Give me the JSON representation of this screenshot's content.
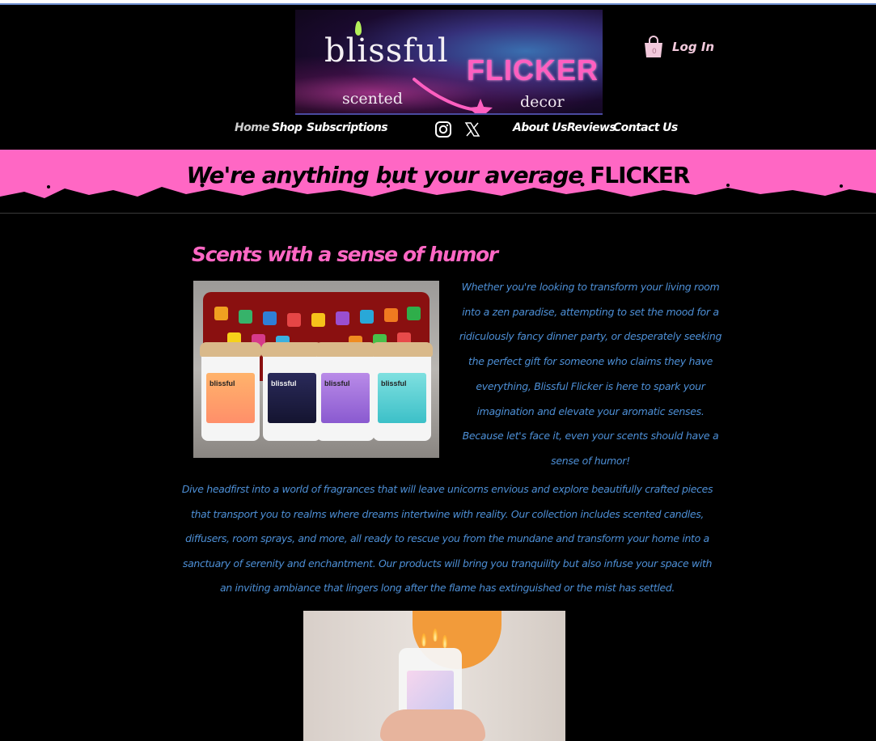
{
  "header": {
    "logo": {
      "brand_line1": "blissful",
      "brand_line2": "FLICKER",
      "tagline_left": "scented",
      "tagline_right": "decor"
    },
    "login_label": "Log In"
  },
  "nav": {
    "left": [
      "Home",
      "Shop",
      "Subscriptions"
    ],
    "right": [
      "About Us",
      "Reviews",
      "Contact Us"
    ],
    "active": "Home"
  },
  "social": [
    "instagram-icon",
    "x-icon"
  ],
  "banner": {
    "text_italic": "We're anything but your average",
    "text_bold": "FLICKER"
  },
  "main": {
    "section_title": "Scents with a sense of humor",
    "paragraph_right": "Whether you're looking to transform your living room into a zen paradise, attempting to set the mood for a ridiculously fancy dinner party, or desperately seeking the perfect gift for someone who claims they have everything, Blissful Flicker is here to spark your imagination and elevate your aromatic senses. Because let's face it, even your scents should have a sense of humor!",
    "paragraph_full": "Dive headfirst into a world of fragrances that will leave unicorns envious and explore beautifully crafted pieces that transport you to realms where dreams intertwine with reality. Our collection includes scented candles, diffusers, room sprays, and more, all ready to rescue you from the mundane and transform your home into a sanctuary of serenity and enchantment. Our products will bring you tranquility but also infuse your space with an inviting ambiance that lingers long after the flame has extinguished or the mist has settled."
  },
  "colors": {
    "accent_pink": "#ff67c4",
    "body_text_blue": "#4d8fd6",
    "background": "#000000"
  }
}
